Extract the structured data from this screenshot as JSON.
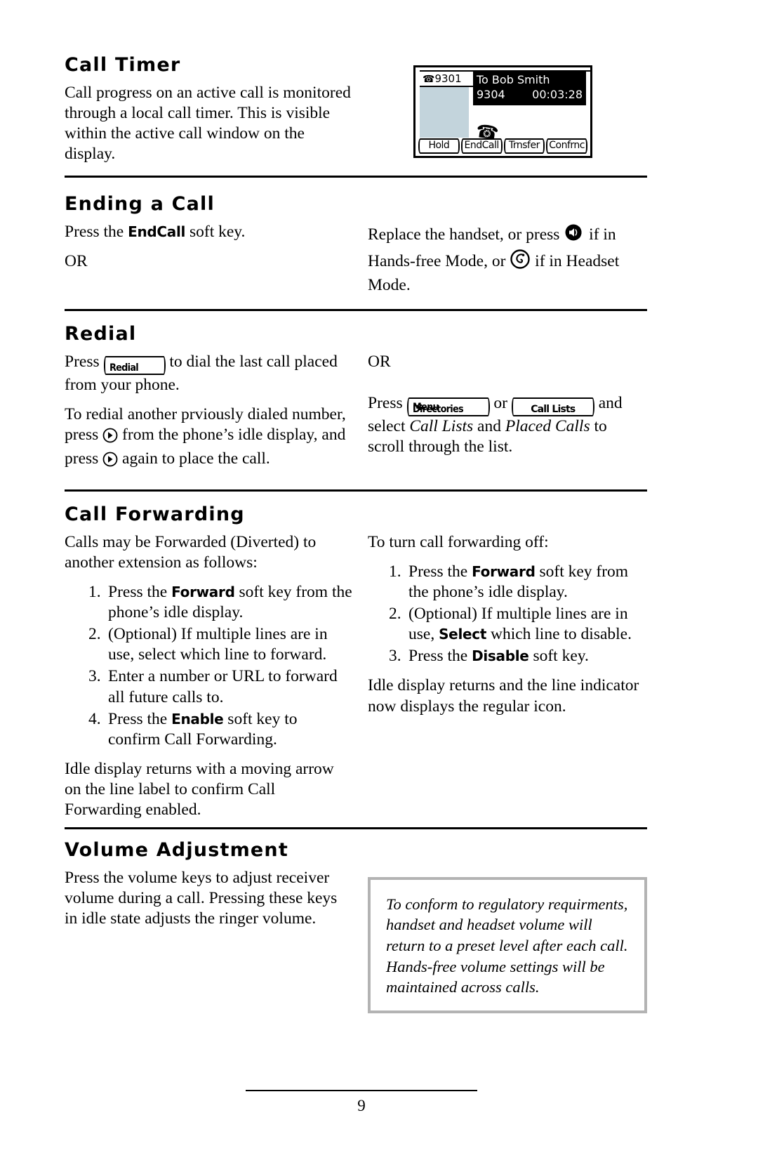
{
  "page_number": "9",
  "sections": [
    {
      "id": "call-timer",
      "title": "Call Timer",
      "body": "Call progress on an active call is monitored through a local call timer.  This is visible within the active call window on the display."
    },
    {
      "id": "ending-a-call",
      "title": "Ending a Call",
      "left": {
        "press_the": "Press the ",
        "softkey": "EndCall",
        "soft_key_suffix": " soft key.",
        "or": "OR"
      },
      "right": {
        "t1": "Replace the handset, or press ",
        "icon1": "speaker-icon",
        "t2": " if in Hands-free Mode, or ",
        "icon2": "headset-icon",
        "t3": " if in Headset Mode."
      }
    },
    {
      "id": "redial",
      "title": "Redial",
      "left": {
        "p1_a": "Press ",
        "key1": "Redial",
        "p1_b": " to dial the last call placed from your phone.",
        "p2_a": "To redial another prviously dialed number, press ",
        "p2_b": " from the phone’s idle display, and press ",
        "p2_c": " again to place the call.",
        "arrow_icon": "right-arrow-circle-icon"
      },
      "right": {
        "or": "OR",
        "p_a": "Press ",
        "key_directories": "Directories",
        "key_menu": "Menu",
        "p_b": " or ",
        "key_calllists": "Call Lists",
        "p_c": " and select ",
        "italic1": "Call Lists",
        "p_d": " and ",
        "italic2": "Placed Calls",
        "p_e": " to scroll through the list."
      }
    },
    {
      "id": "call-forwarding",
      "title": "Call Forwarding",
      "left": {
        "intro": "Calls may be Forwarded (Diverted) to another extension as follows:",
        "steps": [
          {
            "pre": "Press the ",
            "key": "Forward",
            "post": " soft key from the phone’s idle display."
          },
          {
            "pre": "(Optional) If multiple lines are in use, select which line to forward.",
            "key": "",
            "post": ""
          },
          {
            "pre": "Enter a number or URL to forward all future calls to.",
            "key": "",
            "post": ""
          },
          {
            "pre": "Press the ",
            "key": "Enable",
            "post": " soft key to confirm Call Forwarding."
          }
        ],
        "outro": "Idle display returns with a moving arrow on the line label to confirm Call Forwarding enabled."
      },
      "right": {
        "intro": "To turn call forwarding off:",
        "steps": [
          {
            "pre": "Press the ",
            "key": "Forward",
            "post": " soft key from the phone’s idle display."
          },
          {
            "pre": "(Optional) If multiple lines are in use, ",
            "key": "Select",
            "post": " which line to disable."
          },
          {
            "pre": "Press the ",
            "key": "Disable",
            "post": " soft key."
          }
        ],
        "outro": "Idle display returns and the line indicator now displays the regular icon."
      }
    },
    {
      "id": "volume-adjustment",
      "title": "Volume Adjustment",
      "left": {
        "body": "Press the volume keys to adjust receiver volume during a call.  Pressing these keys in idle state adjusts the ringer volume."
      },
      "right": {
        "note": "To conform to regulatory requirments, handset and headset volume will return to a preset level after each call.  Hands-free volume settings will be maintained across calls."
      }
    }
  ],
  "phone_display": {
    "line_icon": "handset-icon",
    "line_label": "9301",
    "call_to": "To Bob Smith",
    "call_number": "9304",
    "call_timer": "00:03:28",
    "active_call_icon": "handset-offhook-icon",
    "soft_keys": [
      "Hold",
      "EndCall",
      "Trnsfer",
      "Confrnc"
    ],
    "colors": {
      "line_col": "#c3d4dc",
      "call_box": "#000000"
    }
  },
  "note_box": {
    "border_color": "#b3b3b3"
  }
}
